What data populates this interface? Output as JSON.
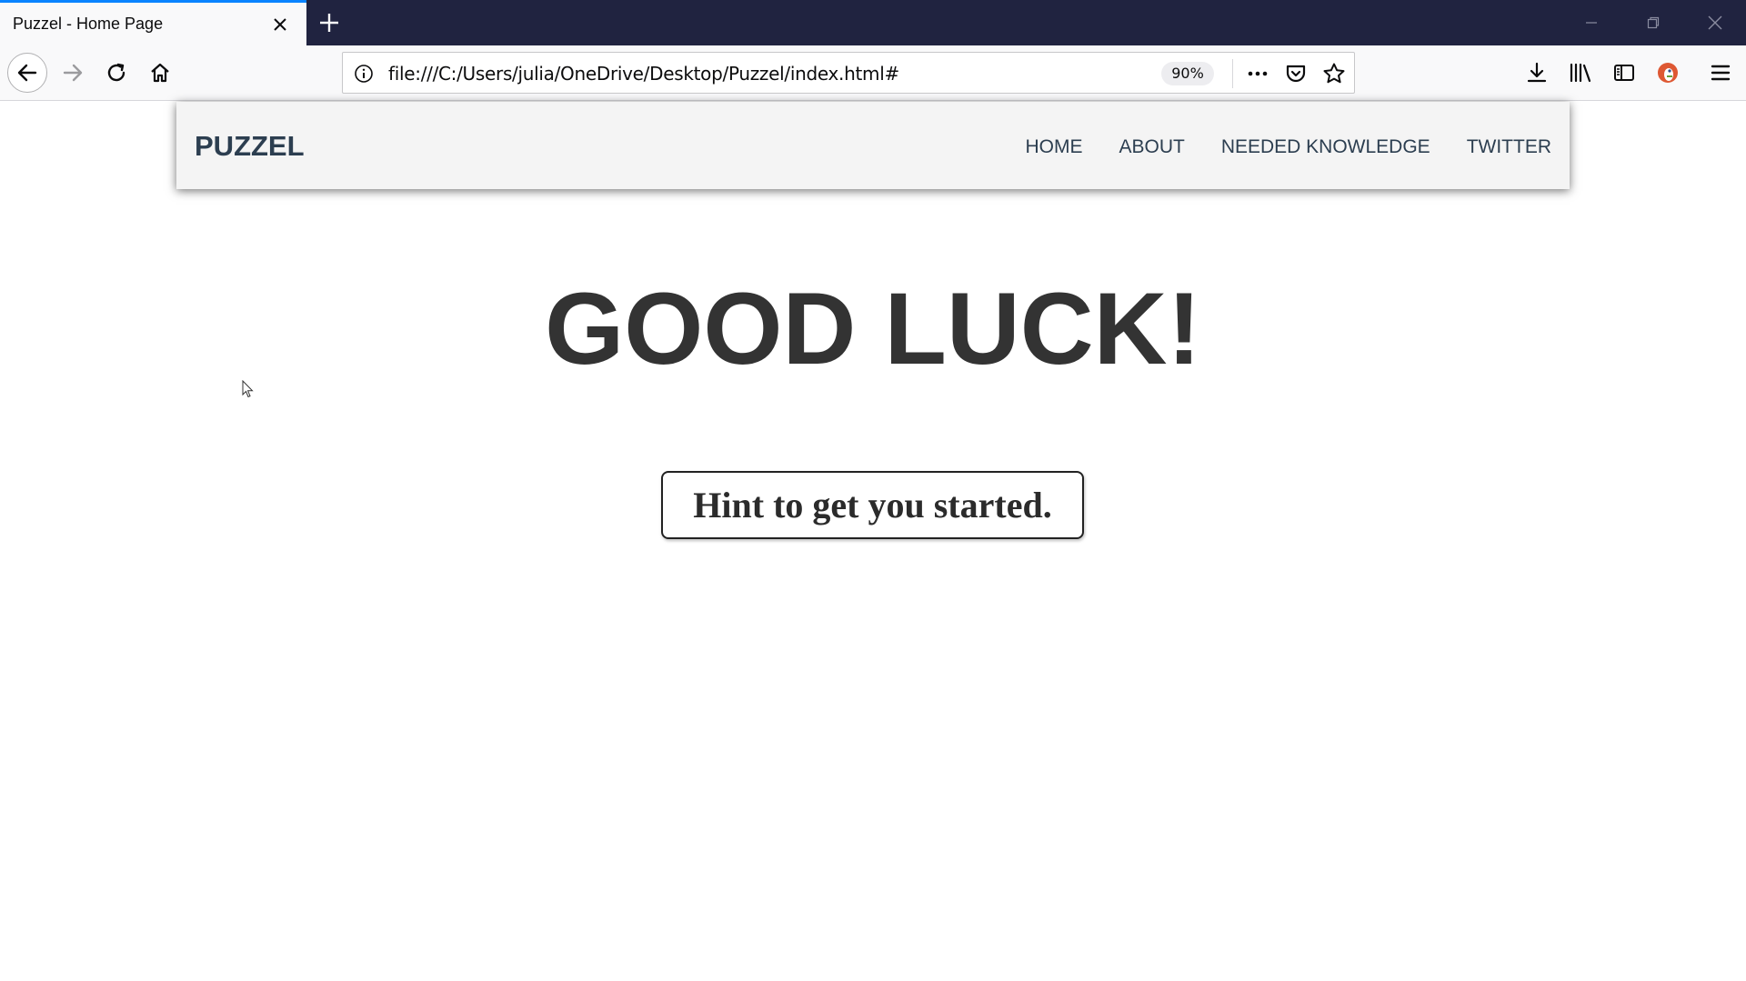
{
  "browser": {
    "tab": {
      "title": "Puzzel - Home Page"
    },
    "url": "file:///C:/Users/julia/OneDrive/Desktop/Puzzel/index.html#",
    "zoom": "90%",
    "icons": {
      "tab_close": "close-icon",
      "new_tab": "plus-icon",
      "minimize": "minimize-icon",
      "restore": "restore-icon",
      "close_window": "close-icon",
      "back": "back-arrow-icon",
      "forward": "forward-arrow-icon",
      "reload": "reload-icon",
      "home": "home-icon",
      "page_info": "info-icon",
      "page_actions": "more-icon",
      "pocket": "pocket-icon",
      "bookmark": "star-icon",
      "downloads": "download-icon",
      "library": "library-icon",
      "sidebar": "sidebar-icon",
      "extension": "duckduckgo-icon",
      "menu": "hamburger-menu-icon"
    },
    "colors": {
      "tabstrip": "#202340",
      "tab_accent": "#0a84ff",
      "toolbar": "#f9f9fa"
    }
  },
  "site": {
    "logo": "PUZZEL",
    "nav": [
      {
        "label": "HOME"
      },
      {
        "label": "ABOUT"
      },
      {
        "label": "NEEDED KNOWLEDGE"
      },
      {
        "label": "TWITTER"
      }
    ],
    "headline": "GOOD LUCK!",
    "hint_button": "Hint to get you started.",
    "colors": {
      "header_bg": "#f4f4f4",
      "nav_text": "#2c3e50",
      "headline_text": "#333333"
    }
  }
}
